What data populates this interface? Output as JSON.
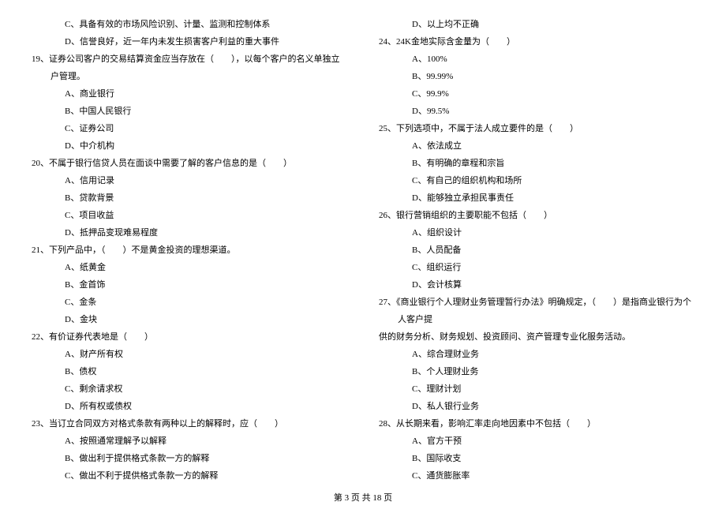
{
  "left": {
    "pre_options": [
      "C、具备有效的市场风险识别、计量、监测和控制体系",
      "D、信誉良好，近一年内未发生损害客户利益的重大事件"
    ],
    "questions": [
      {
        "num": "19、",
        "text": "证券公司客户的交易结算资金应当存放在（　　），以每个客户的名义单独立户管理。",
        "options": [
          "A、商业银行",
          "B、中国人民银行",
          "C、证券公司",
          "D、中介机构"
        ]
      },
      {
        "num": "20、",
        "text": "不属于银行信贷人员在面谈中需要了解的客户信息的是（　　）",
        "options": [
          "A、信用记录",
          "B、贷款背景",
          "C、项目收益",
          "D、抵押品变现难易程度"
        ]
      },
      {
        "num": "21、",
        "text": "下列产品中，（　　）不是黄金投资的理想渠道。",
        "options": [
          "A、纸黄金",
          "B、金首饰",
          "C、金条",
          "D、金块"
        ]
      },
      {
        "num": "22、",
        "text": "有价证券代表地是（　　）",
        "options": [
          "A、财产所有权",
          "B、债权",
          "C、剩余请求权",
          "D、所有权或债权"
        ]
      },
      {
        "num": "23、",
        "text": "当订立合同双方对格式条款有两种以上的解释时，应（　　）",
        "options": [
          "A、按照通常理解予以解释",
          "B、做出利于提供格式条款一方的解释",
          "C、做出不利于提供格式条款一方的解释"
        ]
      }
    ]
  },
  "right": {
    "pre_options": [
      "D、以上均不正确"
    ],
    "questions": [
      {
        "num": "24、",
        "text": "24K金地实际含金量为（　　）",
        "options": [
          "A、100%",
          "B、99.99%",
          "C、99.9%",
          "D、99.5%"
        ]
      },
      {
        "num": "25、",
        "text": "下列选项中，不属于法人成立要件的是（　　）",
        "options": [
          "A、依法成立",
          "B、有明确的章程和宗旨",
          "C、有自己的组织机构和场所",
          "D、能够独立承担民事责任"
        ]
      },
      {
        "num": "26、",
        "text": "银行营销组织的主要职能不包括（　　）",
        "options": [
          "A、组织设计",
          "B、人员配备",
          "C、组织运行",
          "D、会计核算"
        ]
      },
      {
        "num": "27、",
        "text": "《商业银行个人理财业务管理暂行办法》明确规定，（　　）是指商业银行为个人客户提",
        "continuation": "供的财务分析、财务规划、投资顾问、资产管理专业化服务活动。",
        "options": [
          "A、综合理财业务",
          "B、个人理财业务",
          "C、理财计划",
          "D、私人银行业务"
        ]
      },
      {
        "num": "28、",
        "text": "从长期来看，影响汇率走向地因素中不包括（　　）",
        "options": [
          "A、官方干预",
          "B、国际收支",
          "C、通货膨胀率"
        ]
      }
    ]
  },
  "footer": "第 3 页 共 18 页"
}
